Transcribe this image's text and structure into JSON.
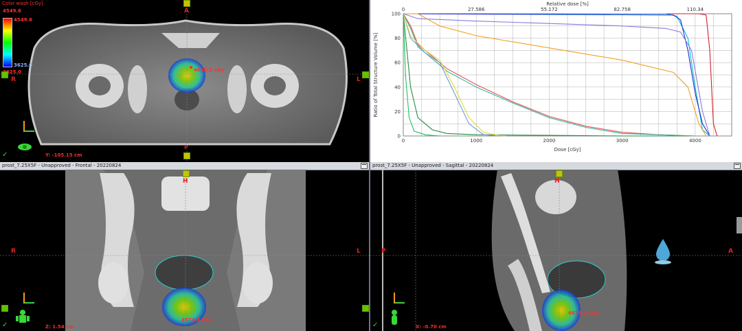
{
  "color_wash": {
    "title": "Color wash [cGy]",
    "max_value": "4549.6",
    "max_marker": "4549.6",
    "min_marker": "3625.0",
    "min_value": "3625.0"
  },
  "axial": {
    "orient_top": "A",
    "orient_left": "R",
    "orient_right": "L",
    "orient_bottom": "P",
    "dose_readout": "4610.1 cGy",
    "coordinate": "Y: -105.15 cm"
  },
  "frontal": {
    "title": "prost_7.25X5F  -  Unapproved - Frontal - 20220824",
    "orient_top": "H",
    "orient_left": "R",
    "orient_right": "L",
    "dose_readout": "4674.3 cGy",
    "coordinate": "Z: 1.54 cm"
  },
  "sagittal": {
    "title": "prost_7.25X5F  -  Unapproved - Sagittal - 20220824",
    "orient_top": "H",
    "orient_left": "P",
    "orient_right": "A",
    "dose_readout": "4674.3 cGy",
    "coordinate": "X: -0.70 cm"
  },
  "chart_data": {
    "type": "line",
    "title": "",
    "x_top_label": "Relative dose [%]",
    "x_top_ticks": [
      "0",
      "27.586",
      "55.172",
      "82.758",
      "110.34"
    ],
    "xlabel": "Dose [cGy]",
    "x_ticks": [
      0,
      1000,
      2000,
      3000,
      4000
    ],
    "xlim": [
      0,
      4500
    ],
    "ylabel": "Ratio of Total Structure Volume [%]",
    "y_ticks": [
      0,
      20,
      40,
      60,
      80,
      100
    ],
    "ylim": [
      0,
      100
    ],
    "grid": true,
    "series": [
      {
        "color": "#d0202a",
        "x": [
          0,
          3900,
          4050,
          4150,
          4200,
          4250,
          4300
        ],
        "y": [
          100,
          100,
          100,
          99,
          70,
          10,
          0
        ]
      },
      {
        "color": "#00c0d0",
        "x": [
          0,
          3600,
          3750,
          3900,
          4000,
          4100,
          4200
        ],
        "y": [
          100,
          100,
          98,
          80,
          40,
          5,
          0
        ]
      },
      {
        "color": "#1a2bd0",
        "x": [
          0,
          3700,
          3800,
          3900,
          4000,
          4100,
          4200
        ],
        "y": [
          100,
          99,
          95,
          70,
          35,
          10,
          0
        ]
      },
      {
        "color": "#8a7ad8",
        "x": [
          0,
          200,
          1000,
          2000,
          3000,
          3600,
          3800,
          3950,
          4100,
          4200
        ],
        "y": [
          100,
          96,
          94,
          92,
          90,
          88,
          85,
          70,
          20,
          0
        ]
      },
      {
        "color": "#f0a020",
        "x": [
          0,
          200,
          500,
          1000,
          2000,
          3000,
          3700,
          3900,
          4050,
          4150
        ],
        "y": [
          100,
          100,
          90,
          82,
          72,
          62,
          52,
          40,
          10,
          0
        ]
      },
      {
        "color": "#2a8a40",
        "x": [
          0,
          50,
          100,
          200,
          400,
          600,
          1000,
          2000,
          3000,
          3800,
          4000
        ],
        "y": [
          100,
          70,
          40,
          15,
          5,
          2,
          1,
          0.5,
          0,
          0,
          0
        ]
      },
      {
        "color": "#e05050",
        "x": [
          0,
          100,
          200,
          400,
          600,
          1000,
          1500,
          2000,
          2500,
          3000,
          3500,
          4000
        ],
        "y": [
          100,
          90,
          75,
          65,
          55,
          42,
          28,
          16,
          8,
          3,
          1,
          0
        ]
      },
      {
        "color": "#3ab0a0",
        "x": [
          0,
          100,
          200,
          400,
          600,
          1000,
          1500,
          2000,
          2500,
          3000,
          3500,
          4000
        ],
        "y": [
          100,
          88,
          73,
          63,
          53,
          40,
          27,
          15,
          7,
          2,
          1,
          0
        ]
      },
      {
        "color": "#6a9ad0",
        "x": [
          0,
          100,
          300,
          500,
          700,
          900,
          1100,
          1300
        ],
        "y": [
          100,
          80,
          68,
          60,
          35,
          10,
          1,
          0
        ]
      },
      {
        "color": "#e8d830",
        "x": [
          0,
          100,
          300,
          500,
          700,
          900,
          1100,
          1300,
          1400
        ],
        "y": [
          100,
          82,
          70,
          62,
          40,
          15,
          3,
          0.5,
          0
        ]
      },
      {
        "color": "#20c060",
        "x": [
          0,
          30,
          80,
          150,
          300,
          500
        ],
        "y": [
          100,
          50,
          15,
          4,
          1,
          0
        ]
      }
    ]
  }
}
